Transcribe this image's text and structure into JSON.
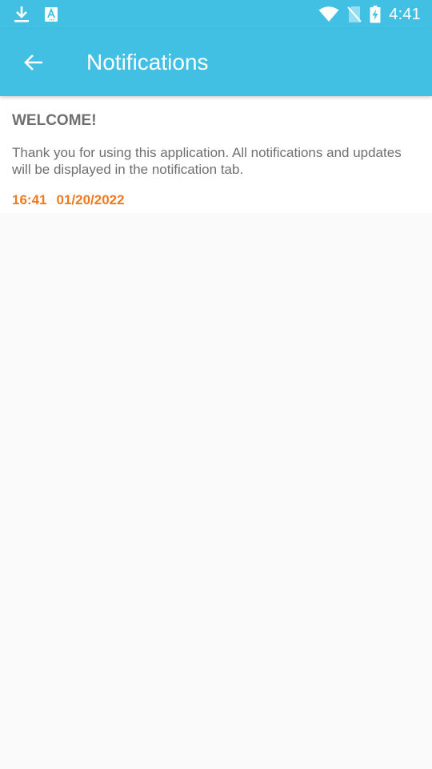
{
  "status_bar": {
    "time": "4:41",
    "icons": [
      "download-icon",
      "a-translate-icon",
      "wifi-icon",
      "no-sim-icon",
      "battery-charging-icon"
    ]
  },
  "app_bar": {
    "title": "Notifications",
    "back_icon": "arrow-back-icon",
    "color": "#42c0e3"
  },
  "notifications": [
    {
      "title": "WELCOME!",
      "body": "Thank you for using this application. All notifications and updates will be displayed in the notification tab.",
      "time": "16:41",
      "date": "01/20/2022"
    }
  ],
  "colors": {
    "accent": "#42c0e3",
    "meta": "#f07a22",
    "text": "#6f6f6f",
    "background": "#fafafa"
  }
}
